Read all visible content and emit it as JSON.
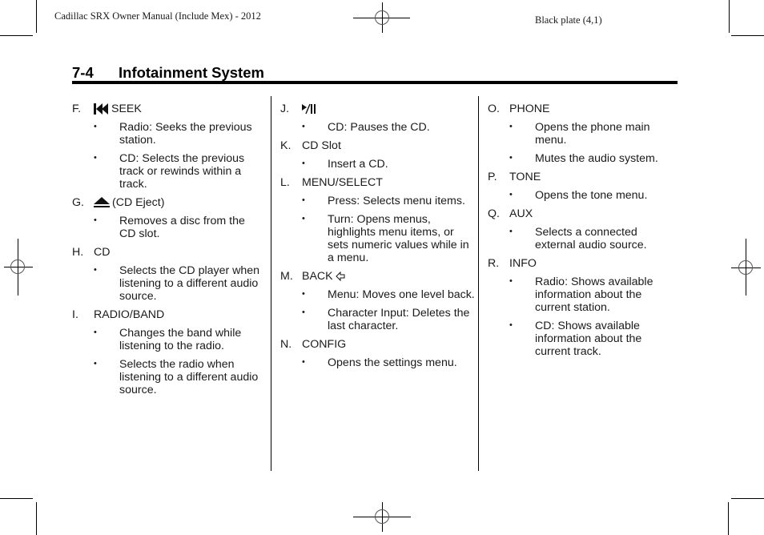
{
  "header": {
    "manual_title": "Cadillac SRX Owner Manual (Include Mex) - 2012",
    "plate": "Black plate (4,1)"
  },
  "section": {
    "number": "7-4",
    "title": "Infotainment System"
  },
  "columns": [
    {
      "items": [
        {
          "letter": "F.",
          "icon": "seek-previous-icon",
          "label": "SEEK",
          "bullets": [
            "Radio: Seeks the previous station.",
            "CD: Selects the previous track or rewinds within a track."
          ]
        },
        {
          "letter": "G.",
          "icon": "eject-icon",
          "label": "(CD Eject)",
          "bullets": [
            "Removes a disc from the CD slot."
          ]
        },
        {
          "letter": "H.",
          "icon": "",
          "label": "CD",
          "bullets": [
            "Selects the CD player when listening to a different audio source."
          ]
        },
        {
          "letter": "I.",
          "icon": "",
          "label": "RADIO/BAND",
          "bullets": [
            "Changes the band while listening to the radio.",
            "Selects the radio when listening to a different audio source."
          ]
        }
      ]
    },
    {
      "items": [
        {
          "letter": "J.",
          "icon": "play-pause-icon",
          "label": "",
          "bullets": [
            "CD: Pauses the CD."
          ]
        },
        {
          "letter": "K.",
          "icon": "",
          "label": "CD Slot",
          "bullets": [
            "Insert a CD."
          ]
        },
        {
          "letter": "L.",
          "icon": "",
          "label": "MENU/SELECT",
          "bullets": [
            "Press: Selects menu items.",
            "Turn: Opens menus, highlights menu items, or sets numeric values while in a menu."
          ]
        },
        {
          "letter": "M.",
          "icon": "back-arrow-icon",
          "label": "BACK",
          "bullets": [
            "Menu: Moves one level back.",
            "Character Input: Deletes the last character."
          ]
        },
        {
          "letter": "N.",
          "icon": "",
          "label": "CONFIG",
          "bullets": [
            "Opens the settings menu."
          ]
        }
      ]
    },
    {
      "items": [
        {
          "letter": "O.",
          "icon": "",
          "label": "PHONE",
          "bullets": [
            "Opens the phone main menu.",
            "Mutes the audio system."
          ]
        },
        {
          "letter": "P.",
          "icon": "",
          "label": "TONE",
          "bullets": [
            "Opens the tone menu."
          ]
        },
        {
          "letter": "Q.",
          "icon": "",
          "label": "AUX",
          "bullets": [
            "Selects a connected external audio source."
          ]
        },
        {
          "letter": "R.",
          "icon": "",
          "label": "INFO",
          "bullets": [
            "Radio: Shows available information about the current station.",
            "CD: Shows available information about the current track."
          ]
        }
      ]
    }
  ],
  "bullet_glyph": "•"
}
